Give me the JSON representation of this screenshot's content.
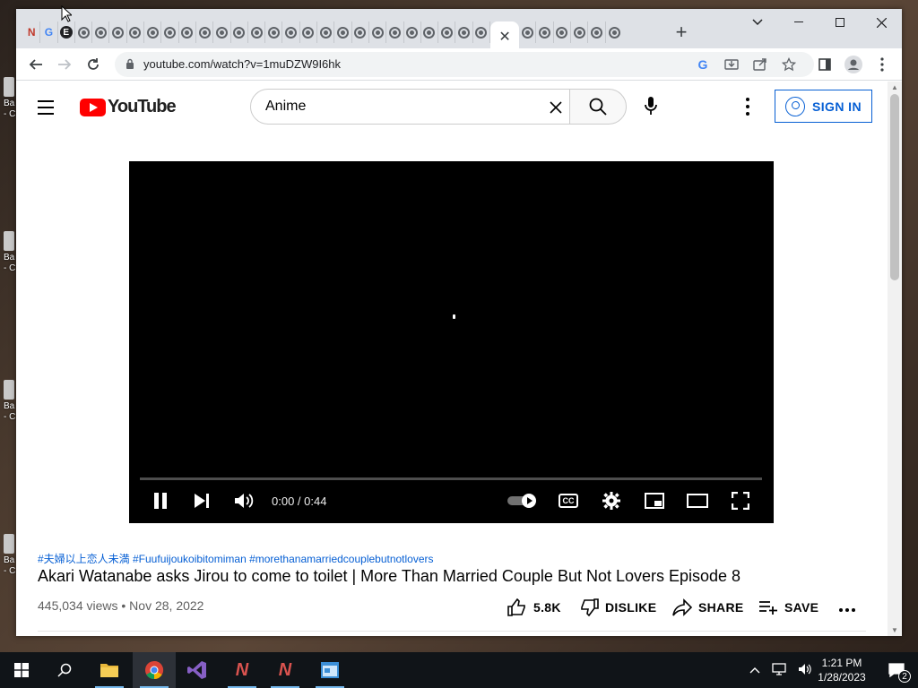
{
  "browser": {
    "url": "youtube.com/watch?v=1muDZW9I6hk",
    "active_tab_close": "✕",
    "new_tab": "+",
    "tab_letters": [
      "N",
      "G",
      "E"
    ]
  },
  "youtube": {
    "logo_text": "YouTube",
    "search_value": "Anime",
    "sign_in_label": "SIGN IN"
  },
  "player": {
    "time_display": "0:00 / 0:44",
    "cc_label": "CC",
    "progress": 0
  },
  "video": {
    "hashtags": "#夫婦以上恋人未満 #Fuufuijoukoibitomiman #morethanamarriedcouplebutnotlovers",
    "title": "Akari Watanabe asks Jirou to come to toilet | More Than Married Couple But Not Lovers Episode 8",
    "views_date": "445,034 views • Nov 28, 2022",
    "likes": "5.8K",
    "dislike_label": "DISLIKE",
    "share_label": "SHARE",
    "save_label": "SAVE"
  },
  "desktop_icons": [
    "Ba - C",
    "Ba - C",
    "Ba - C",
    "Ba - C",
    "Ba - C"
  ],
  "taskbar": {
    "time": "1:21 PM",
    "date": "1/28/2023",
    "notification_count": "2"
  },
  "colors": {
    "yt_red": "#ff0000",
    "link_blue": "#065fd4",
    "taskbar_bg": "#101418"
  }
}
